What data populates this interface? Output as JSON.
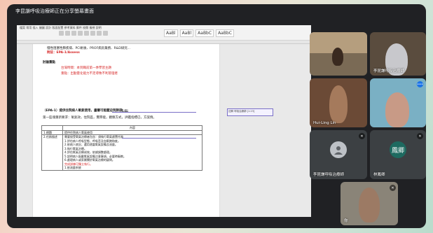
{
  "meeting": {
    "presenter_label": "李昆謙呼吸治療師正在分享螢幕畫面"
  },
  "ribbon": {
    "tabs": "檔案  常用  插入  繪圖  設計  版面配置  參考資料  郵件  校閱  檢視  說明",
    "styles": [
      "AaBl",
      "AaBl",
      "AaBbC",
      "AaBbC"
    ]
  },
  "document": {
    "line1": "慢性阻塞性肺疾病、PCI術後、PROF病房業務、R&D研究...",
    "line2": "附註：EPA-1/Assess",
    "section_label": "討論重點",
    "red1": "台灣時間：本到職前第一季學習主題",
    "red2": "重點：出勤量化能力不足導致不利管理者",
    "epa_heading": "（EPA-1）提供住院病人氧氣使用，畫審可能壓迫到肺部",
    "selected": "處理",
    "body_line": "第一區塊重新要求：氧氣效，住院區，實際能，觀察方式，評鑑指標已，方案情。",
    "table_header": [
      "",
      "內容"
    ],
    "rows": [
      {
        "k": "1.標題",
        "v": "提供住院病人氧氣使用"
      },
      {
        "k": "2.任務描述",
        "v": "需要"
      }
    ],
    "items": [
      "需要接受氧氣治療者包含：須執行氧氣處置任務",
      "1.評估病人呼吸型態、呼吸音及血氧飽和度。",
      "2.依病人病況，選用適當氧氣設備及流量。",
      "3.執行氧氣治療。",
      "4.評估氧氣治療成效，依據調整處理。",
      "5.說明病人配戴氧氣設備注意事項，必要時衛教。",
      "6.處理病人或家屬關於氧氣治療的疑問。",
      "完成訓練可獨立執行。",
      "1.依流量系統"
    ],
    "comment": "註解 呼吸治療師 [1:23]"
  },
  "participants": [
    {
      "name": "",
      "muted": false
    },
    {
      "name": "李昆謙呼吸治療師",
      "muted": false
    },
    {
      "name": "Hui-Ling Lin",
      "muted": false
    },
    {
      "name": "",
      "muted": false
    },
    {
      "name": "李昆謙呼吸治療師",
      "muted": true
    },
    {
      "name": "林鳳卿",
      "muted": true,
      "initials": "鳳卿"
    },
    {
      "name": "你",
      "muted": true
    }
  ],
  "colors": {
    "frame": "#202124",
    "tile_grey": "#3c4043",
    "avatar_green": "#1e6a60",
    "avatar_blue": "#5f6368"
  }
}
